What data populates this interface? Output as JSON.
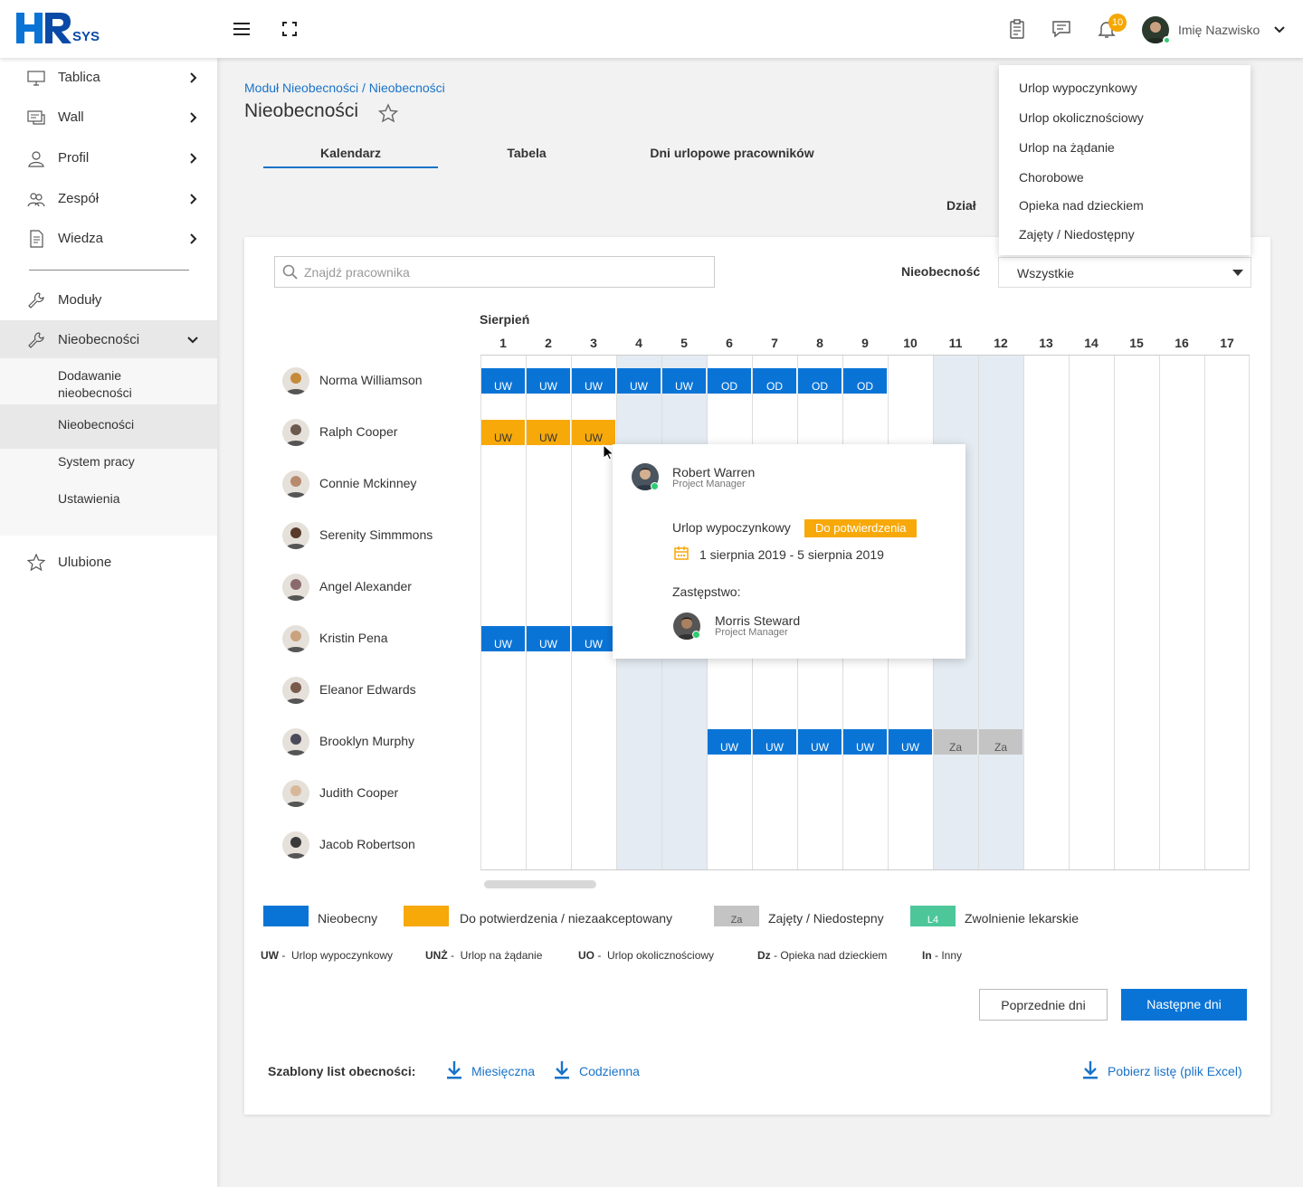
{
  "app": {
    "logo_text": "HR",
    "logo_sub": "SYS"
  },
  "topbar": {
    "notifications_count": "10",
    "user_name": "Imię Nazwisko"
  },
  "sidebar": {
    "items": [
      {
        "label": "Tablica",
        "icon": "monitor-icon"
      },
      {
        "label": "Wall",
        "icon": "wall-icon"
      },
      {
        "label": "Profil",
        "icon": "user-icon"
      },
      {
        "label": "Zespół",
        "icon": "team-icon"
      },
      {
        "label": "Wiedza",
        "icon": "document-icon"
      }
    ],
    "moduly": "Moduły",
    "nieobecnosci": "Nieobecności",
    "sub": [
      "Dodawanie nieobecności",
      "Nieobecności",
      "System pracy",
      "Ustawienia"
    ],
    "ulubione": "Ulubione"
  },
  "page": {
    "breadcrumb": "Moduł Nieobecności / Nieobecności",
    "title": "Nieobecności",
    "tabs": [
      "Kalendarz",
      "Tabela",
      "Dni urlopowe pracowników"
    ],
    "dzial_label": "Dział"
  },
  "filters": {
    "search_placeholder": "Znajdź pracownika",
    "absence_label": "Nieobecność",
    "absence_value": "Wszystkie",
    "dropdown_options": [
      "Urlop wypoczynkowy",
      "Urlop okolicznościowy",
      "Urlop na żądanie",
      "Chorobowe",
      "Opieka nad dzieckiem",
      "Zajęty / Niedostępny"
    ]
  },
  "calendar": {
    "month": "Sierpień",
    "days": [
      "1",
      "2",
      "3",
      "4",
      "5",
      "6",
      "7",
      "8",
      "9",
      "10",
      "11",
      "12",
      "13",
      "14",
      "15",
      "16",
      "17"
    ],
    "weekend_days": [
      4,
      5,
      11,
      12
    ],
    "employees": [
      {
        "name": "Norma Williamson",
        "color": "#c58a3a"
      },
      {
        "name": "Ralph Cooper",
        "color": "#6b5a4e"
      },
      {
        "name": "Connie Mckinney",
        "color": "#b88a6e"
      },
      {
        "name": "Serenity Simmmons",
        "color": "#5a3a2a"
      },
      {
        "name": "Angel Alexander",
        "color": "#8a6a6a"
      },
      {
        "name": "Kristin Pena",
        "color": "#c9a27e"
      },
      {
        "name": "Eleanor Edwards",
        "color": "#7a5a4a"
      },
      {
        "name": "Brooklyn Murphy",
        "color": "#4a4a5a"
      },
      {
        "name": "Judith Cooper",
        "color": "#d8b89a"
      },
      {
        "name": "Jacob Robertson",
        "color": "#3a3a3a"
      }
    ],
    "blocks": [
      {
        "row": 0,
        "day": 1,
        "label": "UW",
        "kind": "blue"
      },
      {
        "row": 0,
        "day": 2,
        "label": "UW",
        "kind": "blue"
      },
      {
        "row": 0,
        "day": 3,
        "label": "UW",
        "kind": "blue"
      },
      {
        "row": 0,
        "day": 4,
        "label": "UW",
        "kind": "blue"
      },
      {
        "row": 0,
        "day": 5,
        "label": "UW",
        "kind": "blue"
      },
      {
        "row": 0,
        "day": 6,
        "label": "OD",
        "kind": "blue"
      },
      {
        "row": 0,
        "day": 7,
        "label": "OD",
        "kind": "blue"
      },
      {
        "row": 0,
        "day": 8,
        "label": "OD",
        "kind": "blue"
      },
      {
        "row": 0,
        "day": 9,
        "label": "OD",
        "kind": "blue"
      },
      {
        "row": 1,
        "day": 1,
        "label": "UW",
        "kind": "yellow"
      },
      {
        "row": 1,
        "day": 2,
        "label": "UW",
        "kind": "yellow"
      },
      {
        "row": 1,
        "day": 3,
        "label": "UW",
        "kind": "yellow"
      },
      {
        "row": 5,
        "day": 1,
        "label": "UW",
        "kind": "blue"
      },
      {
        "row": 5,
        "day": 2,
        "label": "UW",
        "kind": "blue"
      },
      {
        "row": 5,
        "day": 3,
        "label": "UW",
        "kind": "blue"
      },
      {
        "row": 7,
        "day": 6,
        "label": "UW",
        "kind": "blue"
      },
      {
        "row": 7,
        "day": 7,
        "label": "UW",
        "kind": "blue"
      },
      {
        "row": 7,
        "day": 8,
        "label": "UW",
        "kind": "blue"
      },
      {
        "row": 7,
        "day": 9,
        "label": "UW",
        "kind": "blue"
      },
      {
        "row": 7,
        "day": 10,
        "label": "UW",
        "kind": "blue"
      },
      {
        "row": 7,
        "day": 11,
        "label": "Za",
        "kind": "grey"
      },
      {
        "row": 7,
        "day": 12,
        "label": "Za",
        "kind": "grey"
      }
    ]
  },
  "popover": {
    "name": "Robert Warren",
    "role": "Project Manager",
    "type": "Urlop wypoczynkowy",
    "status": "Do potwierdzenia",
    "dates": "1 sierpnia 2019 - 5 sierpnia 2019",
    "substitute_label": "Zastępstwo:",
    "substitute_name": "Morris Steward",
    "substitute_role": "Project Manager"
  },
  "legend": {
    "items": [
      {
        "label": "Nieobecny",
        "color": "#0a74d6",
        "code": ""
      },
      {
        "label": "Do potwierdzenia / niezaakceptowany",
        "color": "#f7a90a",
        "code": ""
      },
      {
        "label": "Zajęty / Niedostepny",
        "color": "#c4c4c4",
        "code": "Za"
      },
      {
        "label": "Zwolnienie lekarskie",
        "color": "#4dc79a",
        "code": "L4"
      }
    ],
    "abbr": [
      {
        "code": "UW",
        "text": "Urlop wypoczynkowy"
      },
      {
        "code": "UNŻ",
        "text": "Urlop na żądanie"
      },
      {
        "code": "UO",
        "text": "Urlop okolicznościowy"
      },
      {
        "code": "Dz",
        "text": "Opieka nad dzieckiem"
      },
      {
        "code": "In",
        "text": "Inny"
      }
    ]
  },
  "buttons": {
    "prev": "Poprzednie dni",
    "next": "Następne dni"
  },
  "downloads": {
    "label": "Szablony list obecności:",
    "monthly": "Miesięczna",
    "daily": "Codzienna",
    "excel": "Pobierz listę (plik Excel)"
  }
}
